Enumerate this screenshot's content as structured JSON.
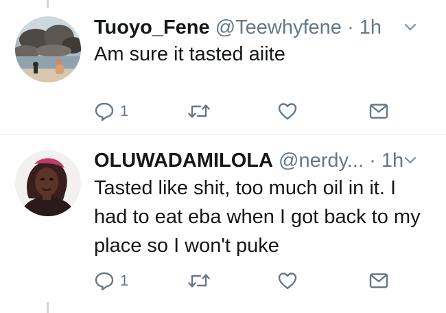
{
  "tweets": [
    {
      "display_name": "Tuoyo_Fene",
      "handle": "@Teewhyfene",
      "separator": "·",
      "time": "1h",
      "text": "Am sure it tasted aiite",
      "reply_count": "1",
      "avatar_icon": "avatar-photo-rocks-beach"
    },
    {
      "display_name": "OLUWADAMILOLA",
      "handle": "@nerdy...",
      "separator": "·",
      "time": "1h",
      "text": "Tasted like shit, too much oil in it. I had to eat eba when I got back to my place so I won't puke",
      "reply_count": "1",
      "avatar_icon": "avatar-photo-person"
    }
  ],
  "colors": {
    "text": "#14171a",
    "muted": "#657786",
    "divider": "#e1e8ed",
    "thread_line": "#ccd6dd"
  }
}
